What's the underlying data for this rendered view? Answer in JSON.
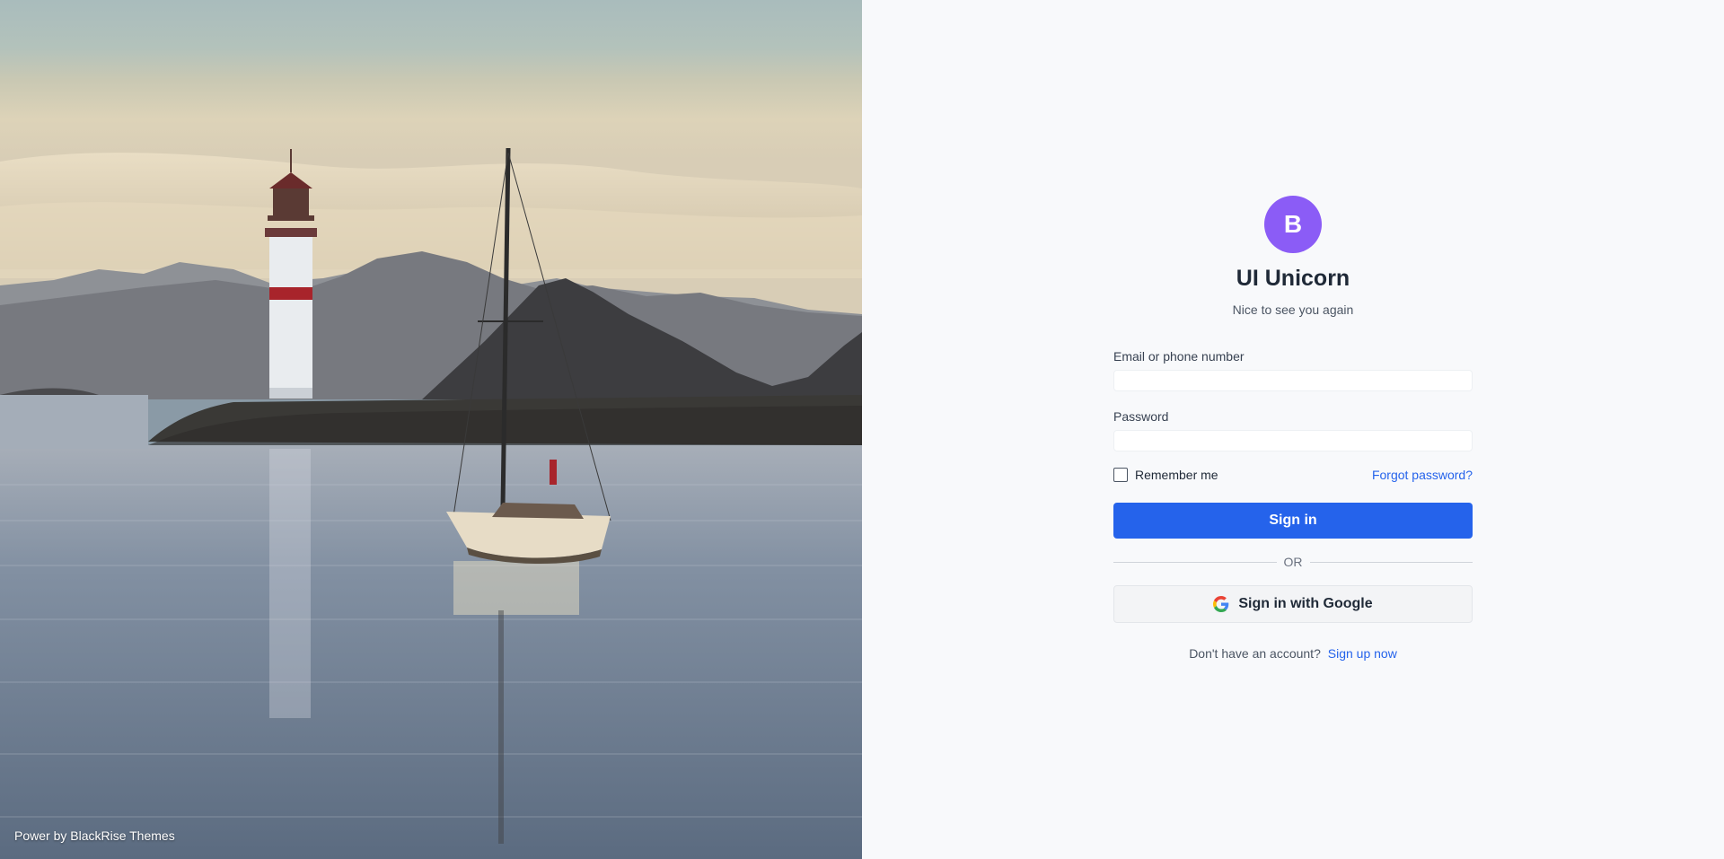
{
  "hero": {
    "credit": "Power by BlackRise Themes"
  },
  "brand": {
    "logo_letter": "B",
    "app_name": "UI Unicorn",
    "tagline": "Nice to see you again"
  },
  "form": {
    "email_label": "Email or phone number",
    "email_value": "",
    "password_label": "Password",
    "password_value": "",
    "remember_label": "Remember me",
    "remember_checked": false,
    "forgot_label": "Forgot password?",
    "signin_label": "Sign in",
    "divider_label": "OR",
    "google_label": "Sign in with Google",
    "signup_prompt": "Don't have an account?",
    "signup_label": "Sign up now"
  },
  "icons": {
    "logo": "letter-avatar",
    "google": "google-g-icon"
  },
  "colors": {
    "primary": "#2563eb",
    "logo_bg": "#8b5cf6",
    "panel_bg": "#f8f9fb"
  }
}
